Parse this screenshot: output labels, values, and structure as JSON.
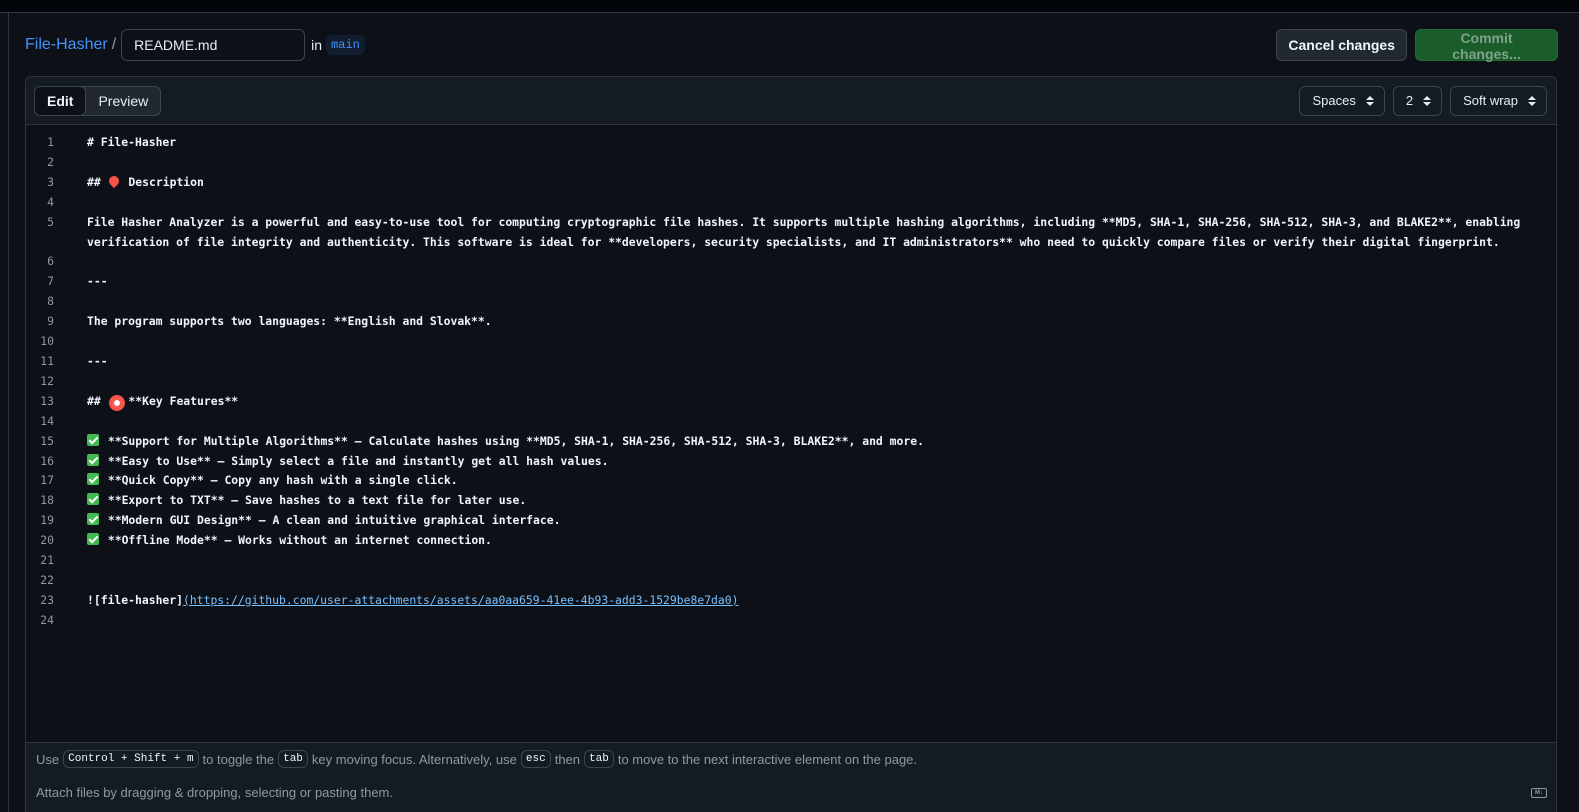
{
  "header": {
    "repo": "File-Hasher",
    "separator": "/",
    "filename": "README.md",
    "in_word": "in",
    "branch": "main",
    "cancel_label": "Cancel changes",
    "commit_label": "Commit changes..."
  },
  "toolbar": {
    "tabs": [
      {
        "label": "Edit",
        "active": true
      },
      {
        "label": "Preview",
        "active": false
      }
    ],
    "indent_mode": "Spaces",
    "indent_size": "2",
    "wrap_mode": "Soft wrap"
  },
  "editor": {
    "lines": [
      {
        "n": "1",
        "text": "# File-Hasher"
      },
      {
        "n": "2",
        "text": ""
      },
      {
        "n": "3",
        "pre": "## ",
        "emoji": "pin-emoji",
        "text": " Description"
      },
      {
        "n": "4",
        "text": ""
      },
      {
        "n": "5",
        "text": "File Hasher Analyzer is a powerful and easy-to-use tool for computing cryptographic file hashes. It supports multiple hashing algorithms, including **MD5, SHA-1, SHA-256, SHA-512, SHA-3, and BLAKE2**, enabling verification of file integrity and authenticity. This software is ideal for **developers, security specialists, and IT administrators** who need to quickly compare files or verify their digital fingerprint."
      },
      {
        "n": "6",
        "text": ""
      },
      {
        "n": "7",
        "text": "---"
      },
      {
        "n": "8",
        "text": ""
      },
      {
        "n": "9",
        "text": "The program supports two languages: **English and Slovak**."
      },
      {
        "n": "10",
        "text": ""
      },
      {
        "n": "11",
        "text": "---"
      },
      {
        "n": "12",
        "text": ""
      },
      {
        "n": "13",
        "pre": "## ",
        "emoji": "target-emoji",
        "text": " **Key Features**"
      },
      {
        "n": "14",
        "text": ""
      },
      {
        "n": "15",
        "emoji": "check-emoji",
        "text": " **Support for Multiple Algorithms** – Calculate hashes using **MD5, SHA-1, SHA-256, SHA-512, SHA-3, BLAKE2**, and more."
      },
      {
        "n": "16",
        "emoji": "check-emoji",
        "text": " **Easy to Use** – Simply select a file and instantly get all hash values."
      },
      {
        "n": "17",
        "emoji": "check-emoji",
        "text": " **Quick Copy** – Copy any hash with a single click."
      },
      {
        "n": "18",
        "emoji": "check-emoji",
        "text": " **Export to TXT** – Save hashes to a text file for later use."
      },
      {
        "n": "19",
        "emoji": "check-emoji",
        "text": " **Modern GUI Design** – A clean and intuitive graphical interface."
      },
      {
        "n": "20",
        "emoji": "check-emoji",
        "text": " **Offline Mode** – Works without an internet connection."
      },
      {
        "n": "21",
        "text": ""
      },
      {
        "n": "22",
        "text": ""
      },
      {
        "n": "23",
        "text": "![file-hasher]",
        "link": "(https://github.com/user-attachments/assets/aa0aa659-41ee-4b93-add3-1529be8e7da0)"
      },
      {
        "n": "24",
        "text": ""
      }
    ]
  },
  "footer": {
    "hint_use": "Use",
    "kbd_toggle": "Control + Shift + m",
    "hint_toggle": "to toggle the",
    "kbd_tab": "tab",
    "hint_focus": "key moving focus. Alternatively, use",
    "kbd_esc": "esc",
    "hint_then": "then",
    "kbd_tab2": "tab",
    "hint_move": "to move to the next interactive element on the page.",
    "attach": "Attach files by dragging & dropping, selecting or pasting them.",
    "md_icon_label": "M↓"
  }
}
